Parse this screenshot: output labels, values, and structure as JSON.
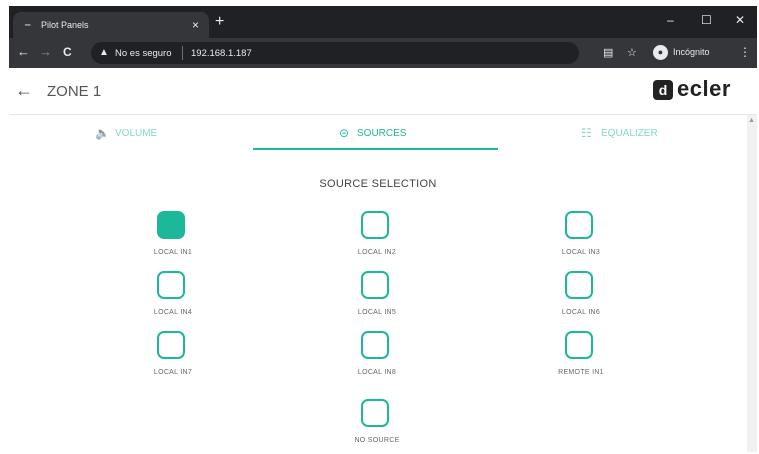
{
  "browser": {
    "tab_title": "Pilot Panels",
    "tab_close": "×",
    "new_tab": "+",
    "window_controls": {
      "minimize": "–",
      "maximize": "☐",
      "close": "✕"
    },
    "nav": {
      "back": "←",
      "forward": "→",
      "reload": "C"
    },
    "security_text": "No es seguro",
    "url": "192.168.1.187",
    "incognito_label": "Incógnito",
    "kebab": "⋮"
  },
  "app": {
    "back": "←",
    "zone_title": "ZONE 1",
    "logo_text": "ecler",
    "logo_mark": "d",
    "accent_color": "#1db89a"
  },
  "tabs": [
    {
      "label": "VOLUME",
      "icon": "speaker-icon",
      "active": false
    },
    {
      "label": "SOURCES",
      "icon": "source-arrow-icon",
      "active": true
    },
    {
      "label": "EQUALIZER",
      "icon": "equalizer-icon",
      "active": false
    }
  ],
  "sources": {
    "title": "SOURCE SELECTION",
    "items": [
      {
        "label": "LOCAL IN1",
        "selected": true
      },
      {
        "label": "LOCAL IN2",
        "selected": false
      },
      {
        "label": "LOCAL IN3",
        "selected": false
      },
      {
        "label": "LOCAL IN4",
        "selected": false
      },
      {
        "label": "LOCAL IN5",
        "selected": false
      },
      {
        "label": "LOCAL IN6",
        "selected": false
      },
      {
        "label": "LOCAL IN7",
        "selected": false
      },
      {
        "label": "LOCAL IN8",
        "selected": false
      },
      {
        "label": "REMOTE IN1",
        "selected": false
      },
      {
        "label": "NO SOURCE",
        "selected": false
      }
    ]
  }
}
